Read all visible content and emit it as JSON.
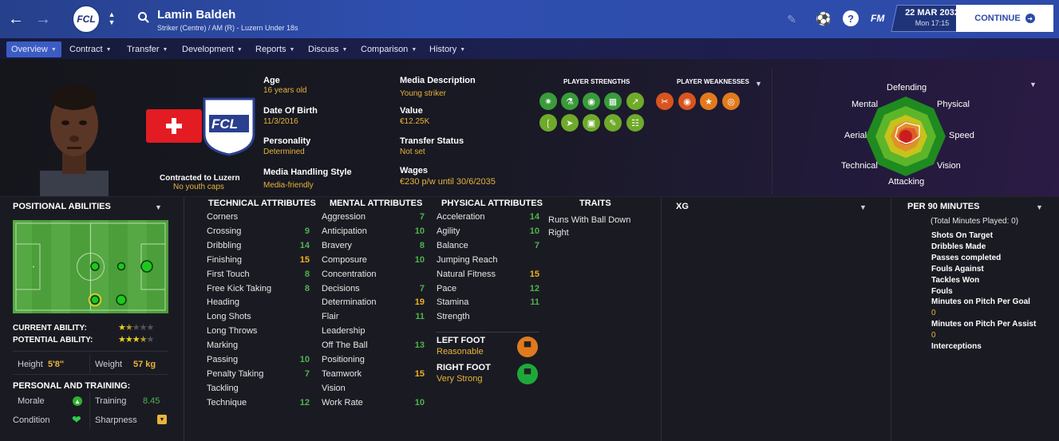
{
  "header": {
    "player_name": "Lamin Baldeh",
    "subtitle": "Striker (Centre) / AM (R) - Luzern Under 18s",
    "club_short": "FCL",
    "date": "22 MAR 2032",
    "time": "Mon 17:15",
    "continue_label": "CONTINUE",
    "fm_label": "FM",
    "help_label": "?"
  },
  "nav": {
    "items": [
      "Overview",
      "Contract",
      "Transfer",
      "Development",
      "Reports",
      "Discuss",
      "Comparison",
      "History"
    ]
  },
  "profile": {
    "contract_label": "Contracted to Luzern",
    "youth_caps": "No youth caps",
    "age_label": "Age",
    "age": "16 years old",
    "dob_label": "Date Of Birth",
    "dob": "11/3/2016",
    "personality_label": "Personality",
    "personality": "Determined",
    "media_style_label": "Media Handling Style",
    "media_style": "Media-friendly",
    "media_desc_label": "Media Description",
    "media_desc": "Young striker",
    "value_label": "Value",
    "value": "€12.25K",
    "transfer_label": "Transfer Status",
    "transfer": "Not set",
    "wages_label": "Wages",
    "wages": "€230 p/w until 30/6/2035",
    "strengths_label": "PLAYER STRENGTHS",
    "weaknesses_label": "PLAYER WEAKNESSES"
  },
  "radar": {
    "labels": {
      "defending": "Defending",
      "physical": "Physical",
      "speed": "Speed",
      "vision": "Vision",
      "attacking": "Attacking",
      "technical": "Technical",
      "aerial": "Aerial",
      "mental": "Mental"
    }
  },
  "positional": {
    "title": "POSITIONAL ABILITIES",
    "current_label": "CURRENT ABILITY:",
    "potential_label": "POTENTIAL ABILITY:",
    "current_stars": 1.5,
    "potential_stars": 3.5,
    "height_label": "Height",
    "height": "5'8\"",
    "weight_label": "Weight",
    "weight": "57 kg",
    "training_title": "PERSONAL AND TRAINING:",
    "morale_label": "Morale",
    "training_label": "Training",
    "training": "8.45",
    "condition_label": "Condition",
    "sharpness_label": "Sharpness"
  },
  "technical": {
    "title": "TECHNICAL ATTRIBUTES",
    "rows": [
      {
        "name": "Corners",
        "value": ""
      },
      {
        "name": "Crossing",
        "value": "9"
      },
      {
        "name": "Dribbling",
        "value": "14"
      },
      {
        "name": "Finishing",
        "value": "15"
      },
      {
        "name": "First Touch",
        "value": "8"
      },
      {
        "name": "Free Kick Taking",
        "value": "8"
      },
      {
        "name": "Heading",
        "value": ""
      },
      {
        "name": "Long Shots",
        "value": ""
      },
      {
        "name": "Long Throws",
        "value": ""
      },
      {
        "name": "Marking",
        "value": ""
      },
      {
        "name": "Passing",
        "value": "10"
      },
      {
        "name": "Penalty Taking",
        "value": "7"
      },
      {
        "name": "Tackling",
        "value": ""
      },
      {
        "name": "Technique",
        "value": "12"
      }
    ]
  },
  "mental": {
    "title": "MENTAL ATTRIBUTES",
    "rows": [
      {
        "name": "Aggression",
        "value": "7"
      },
      {
        "name": "Anticipation",
        "value": "10"
      },
      {
        "name": "Bravery",
        "value": "8"
      },
      {
        "name": "Composure",
        "value": "10"
      },
      {
        "name": "Concentration",
        "value": ""
      },
      {
        "name": "Decisions",
        "value": "7"
      },
      {
        "name": "Determination",
        "value": "19"
      },
      {
        "name": "Flair",
        "value": "11"
      },
      {
        "name": "Leadership",
        "value": ""
      },
      {
        "name": "Off The Ball",
        "value": "13"
      },
      {
        "name": "Positioning",
        "value": ""
      },
      {
        "name": "Teamwork",
        "value": "15"
      },
      {
        "name": "Vision",
        "value": ""
      },
      {
        "name": "Work Rate",
        "value": "10"
      }
    ]
  },
  "physical": {
    "title": "PHYSICAL ATTRIBUTES",
    "rows": [
      {
        "name": "Acceleration",
        "value": "14"
      },
      {
        "name": "Agility",
        "value": "10"
      },
      {
        "name": "Balance",
        "value": "7"
      },
      {
        "name": "Jumping Reach",
        "value": ""
      },
      {
        "name": "Natural Fitness",
        "value": "15"
      },
      {
        "name": "Pace",
        "value": "12"
      },
      {
        "name": "Stamina",
        "value": "11"
      },
      {
        "name": "Strength",
        "value": ""
      }
    ],
    "left_foot_label": "LEFT FOOT",
    "left_foot": "Reasonable",
    "right_foot_label": "RIGHT FOOT",
    "right_foot": "Very Strong"
  },
  "traits": {
    "title": "TRAITS",
    "items": [
      "Runs With Ball Down Right"
    ]
  },
  "xg": {
    "title": "XG"
  },
  "per90": {
    "title": "PER 90 MINUTES",
    "total": "(Total Minutes Played: 0)",
    "stats": [
      "Shots On Target",
      "Dribbles Made",
      "Passes completed",
      "Fouls Against",
      "Tackles Won",
      "Fouls"
    ],
    "mins_goal_label": "Minutes on Pitch Per Goal",
    "mins_goal": "0",
    "mins_assist_label": "Minutes on Pitch Per Assist",
    "mins_assist": "0",
    "interceptions": "Interceptions"
  },
  "colors": {
    "accent": "#3b5cc4",
    "gold": "#e8b33a",
    "green": "#4fb34f",
    "orange": "#f0b020"
  }
}
